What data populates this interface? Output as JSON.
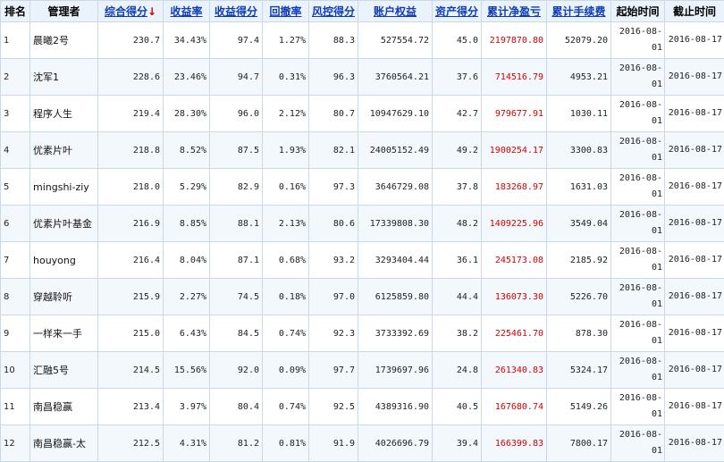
{
  "table": {
    "headers": {
      "rank": "排名",
      "manager": "管理者",
      "composite": "综合得分",
      "sort_arrow": "↓",
      "return_rate": "收益率",
      "return_score": "收益得分",
      "drawdown": "回撤率",
      "risk_score": "风控得分",
      "equity": "账户权益",
      "asset_score": "资产得分",
      "net_pnl": "累计净盈亏",
      "fees": "累计手续费",
      "start": "起始时间",
      "end": "截止时间"
    },
    "rows": [
      {
        "rank": "1",
        "manager": "晨曦2号",
        "composite": "230.7",
        "return_rate": "34.43%",
        "return_score": "97.4",
        "drawdown": "1.27%",
        "risk_score": "88.3",
        "equity": "527554.72",
        "asset_score": "45.0",
        "net_pnl": "2197870.80",
        "fees": "52079.20",
        "start": "2016-08-01",
        "end": "2016-08-17"
      },
      {
        "rank": "2",
        "manager": "沈军1",
        "composite": "228.6",
        "return_rate": "23.46%",
        "return_score": "94.7",
        "drawdown": "0.31%",
        "risk_score": "96.3",
        "equity": "3760564.21",
        "asset_score": "37.6",
        "net_pnl": "714516.79",
        "fees": "4953.21",
        "start": "2016-08-01",
        "end": "2016-08-17"
      },
      {
        "rank": "3",
        "manager": "程序人生",
        "composite": "219.4",
        "return_rate": "28.30%",
        "return_score": "96.0",
        "drawdown": "2.12%",
        "risk_score": "80.7",
        "equity": "10947629.10",
        "asset_score": "42.7",
        "net_pnl": "979677.91",
        "fees": "1030.11",
        "start": "2016-08-01",
        "end": "2016-08-17"
      },
      {
        "rank": "4",
        "manager": "优素片叶",
        "composite": "218.8",
        "return_rate": "8.52%",
        "return_score": "87.5",
        "drawdown": "1.93%",
        "risk_score": "82.1",
        "equity": "24005152.49",
        "asset_score": "49.2",
        "net_pnl": "1900254.17",
        "fees": "3300.83",
        "start": "2016-08-01",
        "end": "2016-08-17"
      },
      {
        "rank": "5",
        "manager": "mingshi-ziy",
        "composite": "218.0",
        "return_rate": "5.29%",
        "return_score": "82.9",
        "drawdown": "0.16%",
        "risk_score": "97.3",
        "equity": "3646729.08",
        "asset_score": "37.8",
        "net_pnl": "183268.97",
        "fees": "1631.03",
        "start": "2016-08-01",
        "end": "2016-08-17"
      },
      {
        "rank": "6",
        "manager": "优素片叶基金",
        "composite": "216.9",
        "return_rate": "8.85%",
        "return_score": "88.1",
        "drawdown": "2.13%",
        "risk_score": "80.6",
        "equity": "17339808.30",
        "asset_score": "48.2",
        "net_pnl": "1409225.96",
        "fees": "3549.04",
        "start": "2016-08-01",
        "end": "2016-08-17"
      },
      {
        "rank": "7",
        "manager": "houyong",
        "composite": "216.4",
        "return_rate": "8.04%",
        "return_score": "87.1",
        "drawdown": "0.68%",
        "risk_score": "93.2",
        "equity": "3293404.44",
        "asset_score": "36.1",
        "net_pnl": "245173.08",
        "fees": "2185.92",
        "start": "2016-08-01",
        "end": "2016-08-17"
      },
      {
        "rank": "8",
        "manager": "穿越聆听",
        "composite": "215.9",
        "return_rate": "2.27%",
        "return_score": "74.5",
        "drawdown": "0.18%",
        "risk_score": "97.0",
        "equity": "6125859.80",
        "asset_score": "44.4",
        "net_pnl": "136073.30",
        "fees": "5226.70",
        "start": "2016-08-01",
        "end": "2016-08-17"
      },
      {
        "rank": "9",
        "manager": "一样来一手",
        "composite": "215.0",
        "return_rate": "6.43%",
        "return_score": "84.5",
        "drawdown": "0.74%",
        "risk_score": "92.3",
        "equity": "3733392.69",
        "asset_score": "38.2",
        "net_pnl": "225461.70",
        "fees": "878.30",
        "start": "2016-08-01",
        "end": "2016-08-17"
      },
      {
        "rank": "10",
        "manager": "汇融5号",
        "composite": "214.5",
        "return_rate": "15.56%",
        "return_score": "92.0",
        "drawdown": "0.09%",
        "risk_score": "97.7",
        "equity": "1739697.96",
        "asset_score": "24.8",
        "net_pnl": "261340.83",
        "fees": "5324.17",
        "start": "2016-08-01",
        "end": "2016-08-17"
      },
      {
        "rank": "11",
        "manager": "南昌稳赢",
        "composite": "213.4",
        "return_rate": "3.97%",
        "return_score": "80.4",
        "drawdown": "0.74%",
        "risk_score": "92.5",
        "equity": "4389316.90",
        "asset_score": "40.5",
        "net_pnl": "167680.74",
        "fees": "5149.26",
        "start": "2016-08-01",
        "end": "2016-08-17"
      },
      {
        "rank": "12",
        "manager": "南昌稳赢-太",
        "composite": "212.5",
        "return_rate": "4.31%",
        "return_score": "81.2",
        "drawdown": "0.81%",
        "risk_score": "91.9",
        "equity": "4026696.79",
        "asset_score": "39.4",
        "net_pnl": "166399.83",
        "fees": "7800.17",
        "start": "2016-08-01",
        "end": "2016-08-17"
      }
    ]
  },
  "colors": {
    "header_bg": "#eaf3fc",
    "link": "#0f3cb8",
    "loss_profit_red": "#d40000",
    "border": "#c9d9e8",
    "alt_row": "#f3f8fd"
  }
}
